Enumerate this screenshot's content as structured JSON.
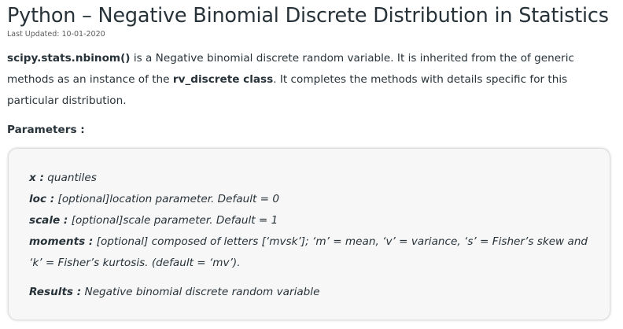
{
  "article": {
    "title": "Python – Negative Binomial Discrete Distribution in Statistics",
    "last_updated": "Last Updated: 10-01-2020",
    "intro": {
      "func": "scipy.stats.nbinom()",
      "text1": " is a Negative binomial discrete random variable. It is inherited from the of generic methods as an instance of the ",
      "class_name": "rv_discrete class",
      "text2": ". It completes the methods with details specific for this particular distribution."
    },
    "parameters_heading": "Parameters :"
  },
  "params_box": {
    "items": [
      {
        "name": "x :",
        "desc": " quantiles"
      },
      {
        "name": "loc :",
        "desc": " [optional]location parameter. Default = 0"
      },
      {
        "name": "scale :",
        "desc": " [optional]scale parameter. Default = 1"
      },
      {
        "name": "moments :",
        "desc": " [optional] composed of letters [‘mvsk’]; ‘m’ = mean, ‘v’ = variance, ‘s’ = Fisher’s skew and ‘k’ = Fisher’s kurtosis. (default = ‘mv’)."
      }
    ],
    "results": {
      "name": "Results :",
      "desc": " Negative binomial discrete random variable"
    }
  }
}
